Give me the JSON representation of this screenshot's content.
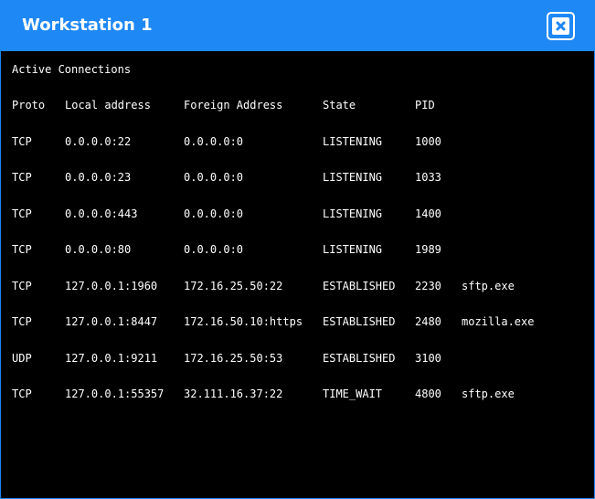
{
  "window": {
    "title": "Workstation 1"
  },
  "terminal": {
    "heading": "Active Connections",
    "columns": [
      "Proto",
      "Local address",
      "Foreign Address",
      "State",
      "PID"
    ],
    "rows": [
      [
        "TCP",
        "0.0.0.0:22",
        "0.0.0.0:0",
        "LISTENING",
        "1000",
        ""
      ],
      [
        "TCP",
        "0.0.0.0:23",
        "0.0.0.0:0",
        "LISTENING",
        "1033",
        ""
      ],
      [
        "TCP",
        "0.0.0.0:443",
        "0.0.0.0:0",
        "LISTENING",
        "1400",
        ""
      ],
      [
        "TCP",
        "0.0.0.0:80",
        "0.0.0.0:0",
        "LISTENING",
        "1989",
        ""
      ],
      [
        "TCP",
        "127.0.0.1:1960",
        "172.16.25.50:22",
        "ESTABLISHED",
        "2230",
        "sftp.exe"
      ],
      [
        "TCP",
        "127.0.0.1:8447",
        "172.16.50.10:https",
        "ESTABLISHED",
        "2480",
        "mozilla.exe"
      ],
      [
        "UDP",
        "127.0.0.1:9211",
        "172.16.25.50:53",
        "ESTABLISHED",
        "3100",
        ""
      ],
      [
        "TCP",
        "127.0.0.1:55357",
        "32.111.16.37:22",
        "TIME_WAIT",
        "4800",
        "sftp.exe"
      ]
    ]
  },
  "colors": {
    "titlebar": "#1e88f5",
    "terminal_bg": "#000000",
    "text": "#ffffff"
  },
  "icons": {
    "close": "close-icon"
  }
}
